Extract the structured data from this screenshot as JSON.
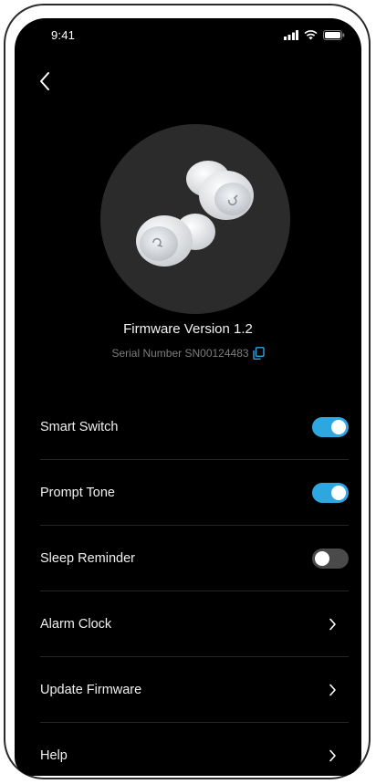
{
  "status_bar": {
    "time": "9:41",
    "icons": [
      "signal-icon",
      "wifi-icon",
      "battery-icon"
    ]
  },
  "navigation": {
    "back_icon": "chevron-left-icon"
  },
  "device": {
    "firmware_version": "Firmware Version 1.2",
    "serial_number": "Serial Number SN00124483",
    "copy_icon": "copy-icon"
  },
  "settings": {
    "smart_switch": {
      "label": "Smart Switch",
      "enabled": true
    },
    "prompt_tone": {
      "label": "Prompt Tone",
      "enabled": true
    },
    "sleep_reminder": {
      "label": "Sleep Reminder",
      "enabled": false
    },
    "alarm_clock": {
      "label": "Alarm Clock"
    },
    "update_firmware": {
      "label": "Update Firmware"
    },
    "help": {
      "label": "Help"
    }
  },
  "colors": {
    "background": "#000000",
    "accent": "#2ea6e0",
    "toggle_off": "#4a4a4a",
    "secondary_text": "#7c7c7c"
  }
}
